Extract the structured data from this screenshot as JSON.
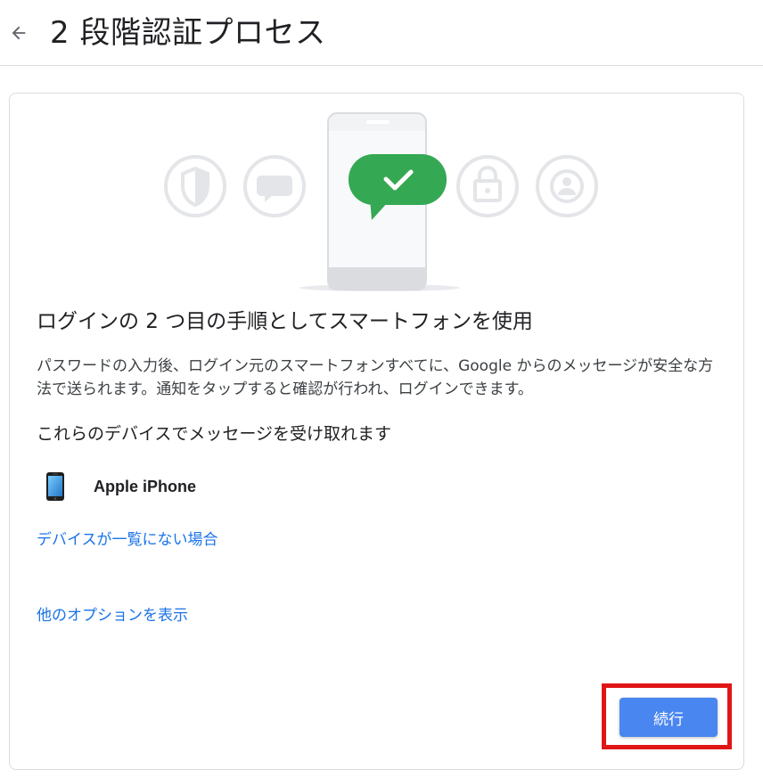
{
  "header": {
    "back_icon": "arrow-back-icon",
    "title": "2 段階認証プロセス"
  },
  "illustration": {
    "icons": [
      "shield-icon",
      "chat-bubble-icon",
      "phone-icon",
      "check-bubble-icon",
      "lock-icon",
      "account-icon"
    ],
    "accent_color": "#34a853"
  },
  "main": {
    "heading": "ログインの 2 つ目の手順としてスマートフォンを使用",
    "description": "パスワードの入力後、ログイン元のスマートフォンすべてに、Google からのメッセージが安全な方法で送られます。通知をタップすると確認が行われ、ログインできます。",
    "devices_heading": "これらのデバイスでメッセージを受け取れます",
    "devices": [
      {
        "name": "Apple iPhone",
        "icon": "smartphone-icon"
      }
    ],
    "link_missing_device": "デバイスが一覧にない場合",
    "link_more_options": "他のオプションを表示",
    "continue_label": "続行"
  },
  "colors": {
    "link": "#1a73e8",
    "button": "#4a86f0",
    "highlight": "#e01616"
  }
}
